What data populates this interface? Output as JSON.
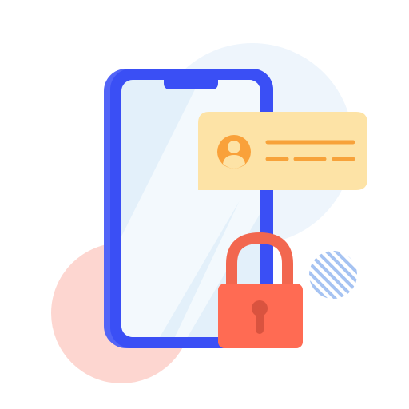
{
  "illustration": {
    "subject": "phone-security-lock",
    "colors": {
      "background": "#ffffff",
      "blue_circle": "#eef5fc",
      "pink_circle": "#fdd6d0",
      "phone_body": "#3a4ff5",
      "phone_edge": "#5264f7",
      "screen": "#e3f0fa",
      "screen_streak": "#f3f9fd",
      "card": "#fde3a6",
      "card_accent": "#f7a23a",
      "avatar_bg": "#f9a13a",
      "lock_shackle": "#f2674f",
      "lock_body": "#ff6b53",
      "keyhole": "#d9533f",
      "stripes": "#a6c3f2"
    }
  }
}
